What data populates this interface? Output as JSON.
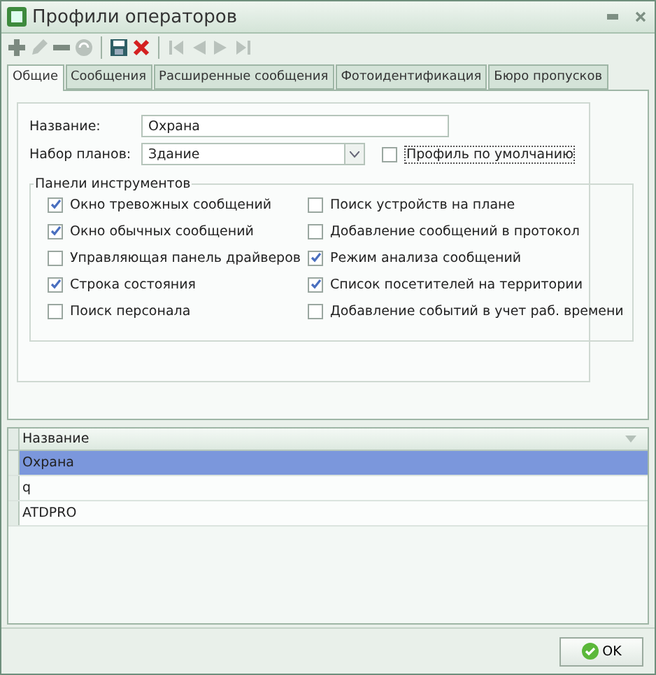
{
  "window": {
    "title": "Профили операторов"
  },
  "toolbar": [
    {
      "kind": "add",
      "disabled": false
    },
    {
      "kind": "edit",
      "disabled": true
    },
    {
      "kind": "remove",
      "disabled": false
    },
    {
      "kind": "refresh",
      "disabled": true
    },
    {
      "kind": "separator"
    },
    {
      "kind": "save",
      "disabled": false
    },
    {
      "kind": "delete",
      "disabled": false
    },
    {
      "kind": "separator"
    },
    {
      "kind": "first",
      "disabled": true
    },
    {
      "kind": "prev",
      "disabled": true
    },
    {
      "kind": "next",
      "disabled": true
    },
    {
      "kind": "last",
      "disabled": true
    }
  ],
  "tabs": [
    {
      "label": "Общие",
      "selected": true
    },
    {
      "label": "Сообщения",
      "selected": false
    },
    {
      "label": "Расширенные сообщения",
      "selected": false
    },
    {
      "label": "Фотоидентификация",
      "selected": false
    },
    {
      "label": "Бюро пропусков",
      "selected": false
    }
  ],
  "form": {
    "name_label": "Название:",
    "name_value": "Охрана",
    "plans_label": "Набор планов:",
    "plans_value": "Здание",
    "default_profile": {
      "label": "Профиль по умолчанию",
      "checked": false
    }
  },
  "toolbars_group": {
    "title": "Панели инструментов",
    "left": [
      {
        "label": "Окно тревожных сообщений",
        "checked": true
      },
      {
        "label": "Окно обычных сообщений",
        "checked": true
      },
      {
        "label": "Управляющая панель драйверов",
        "checked": false
      },
      {
        "label": "Строка состояния",
        "checked": true
      },
      {
        "label": "Поиск персонала",
        "checked": false
      }
    ],
    "right": [
      {
        "label": "Поиск устройств на плане",
        "checked": false
      },
      {
        "label": "Добавление сообщений в протокол",
        "checked": false
      },
      {
        "label": "Режим анализа сообщений",
        "checked": true
      },
      {
        "label": "Список посетителей на территории",
        "checked": true
      },
      {
        "label": "Добавление событий в учет раб. времени",
        "checked": false
      }
    ]
  },
  "table": {
    "columns": [
      "Название"
    ],
    "rows": [
      {
        "cells": [
          "Охрана"
        ],
        "selected": true
      },
      {
        "cells": [
          "q"
        ],
        "selected": false
      },
      {
        "cells": [
          "ATDPRO"
        ],
        "selected": false
      }
    ]
  },
  "buttons": [
    {
      "label": "OK"
    }
  ]
}
